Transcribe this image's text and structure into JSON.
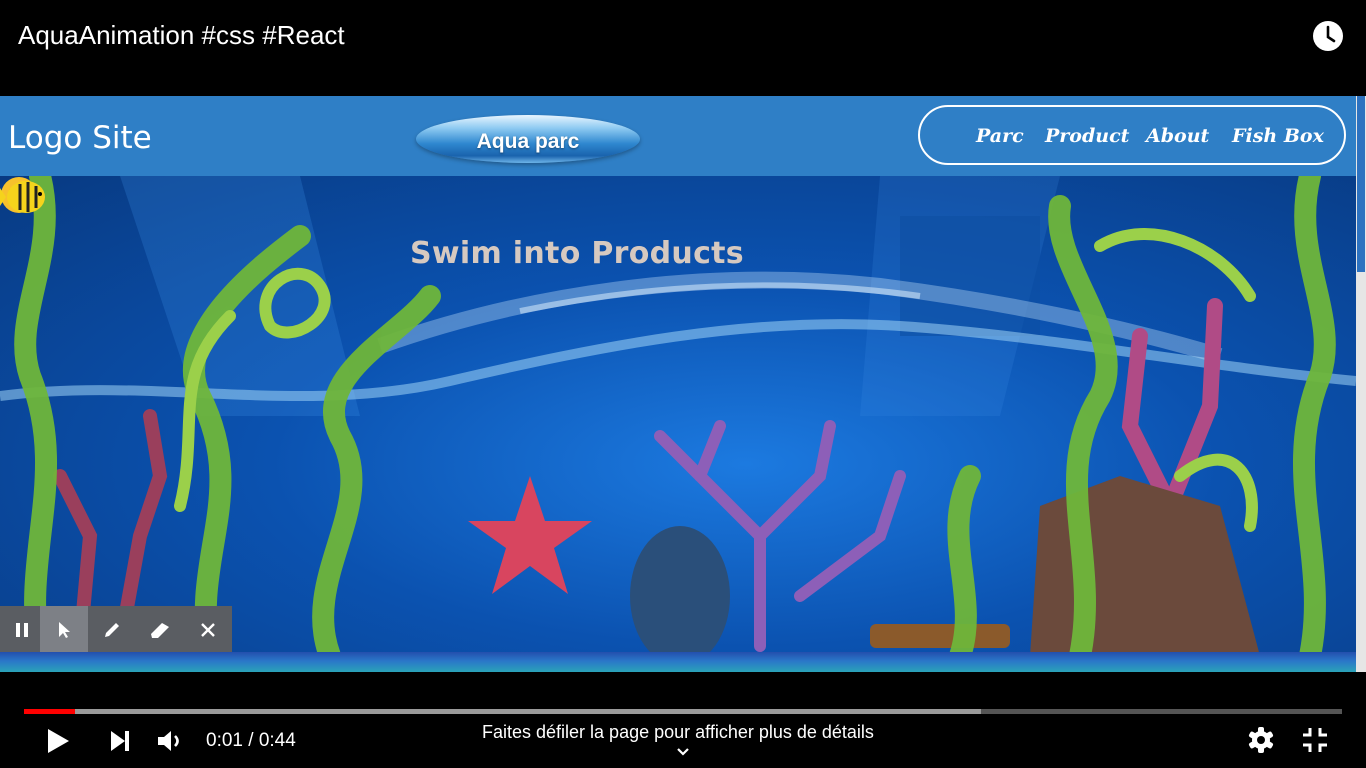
{
  "video": {
    "title": "AquaAnimation #css #React",
    "watch_later_icon": "clock-icon"
  },
  "site": {
    "logo": "Logo Site",
    "center_button": "Aqua parc",
    "nav_links": [
      {
        "label": "Parc"
      },
      {
        "label": "Product"
      },
      {
        "label": "About"
      },
      {
        "label": "Fish Box"
      }
    ],
    "hero_title": "Swim into Products",
    "hero_emoji": "winking-face-icon",
    "nav_color": "#2f7fc6"
  },
  "annotation_toolbar": {
    "tools": [
      "pause-icon",
      "pointer-icon",
      "pencil-icon",
      "eraser-icon",
      "close-icon"
    ],
    "active_tool": "pointer-icon"
  },
  "player": {
    "time": "0:01 / 0:44",
    "scroll_hint": "Faites défiler la page pour afficher plus de détails",
    "played_fraction": 0.039,
    "buffered_fraction": 0.726,
    "played_color": "#ff0000",
    "controls": [
      "play-icon",
      "next-icon",
      "volume-icon",
      "settings-icon",
      "exit-fullscreen-icon"
    ]
  }
}
